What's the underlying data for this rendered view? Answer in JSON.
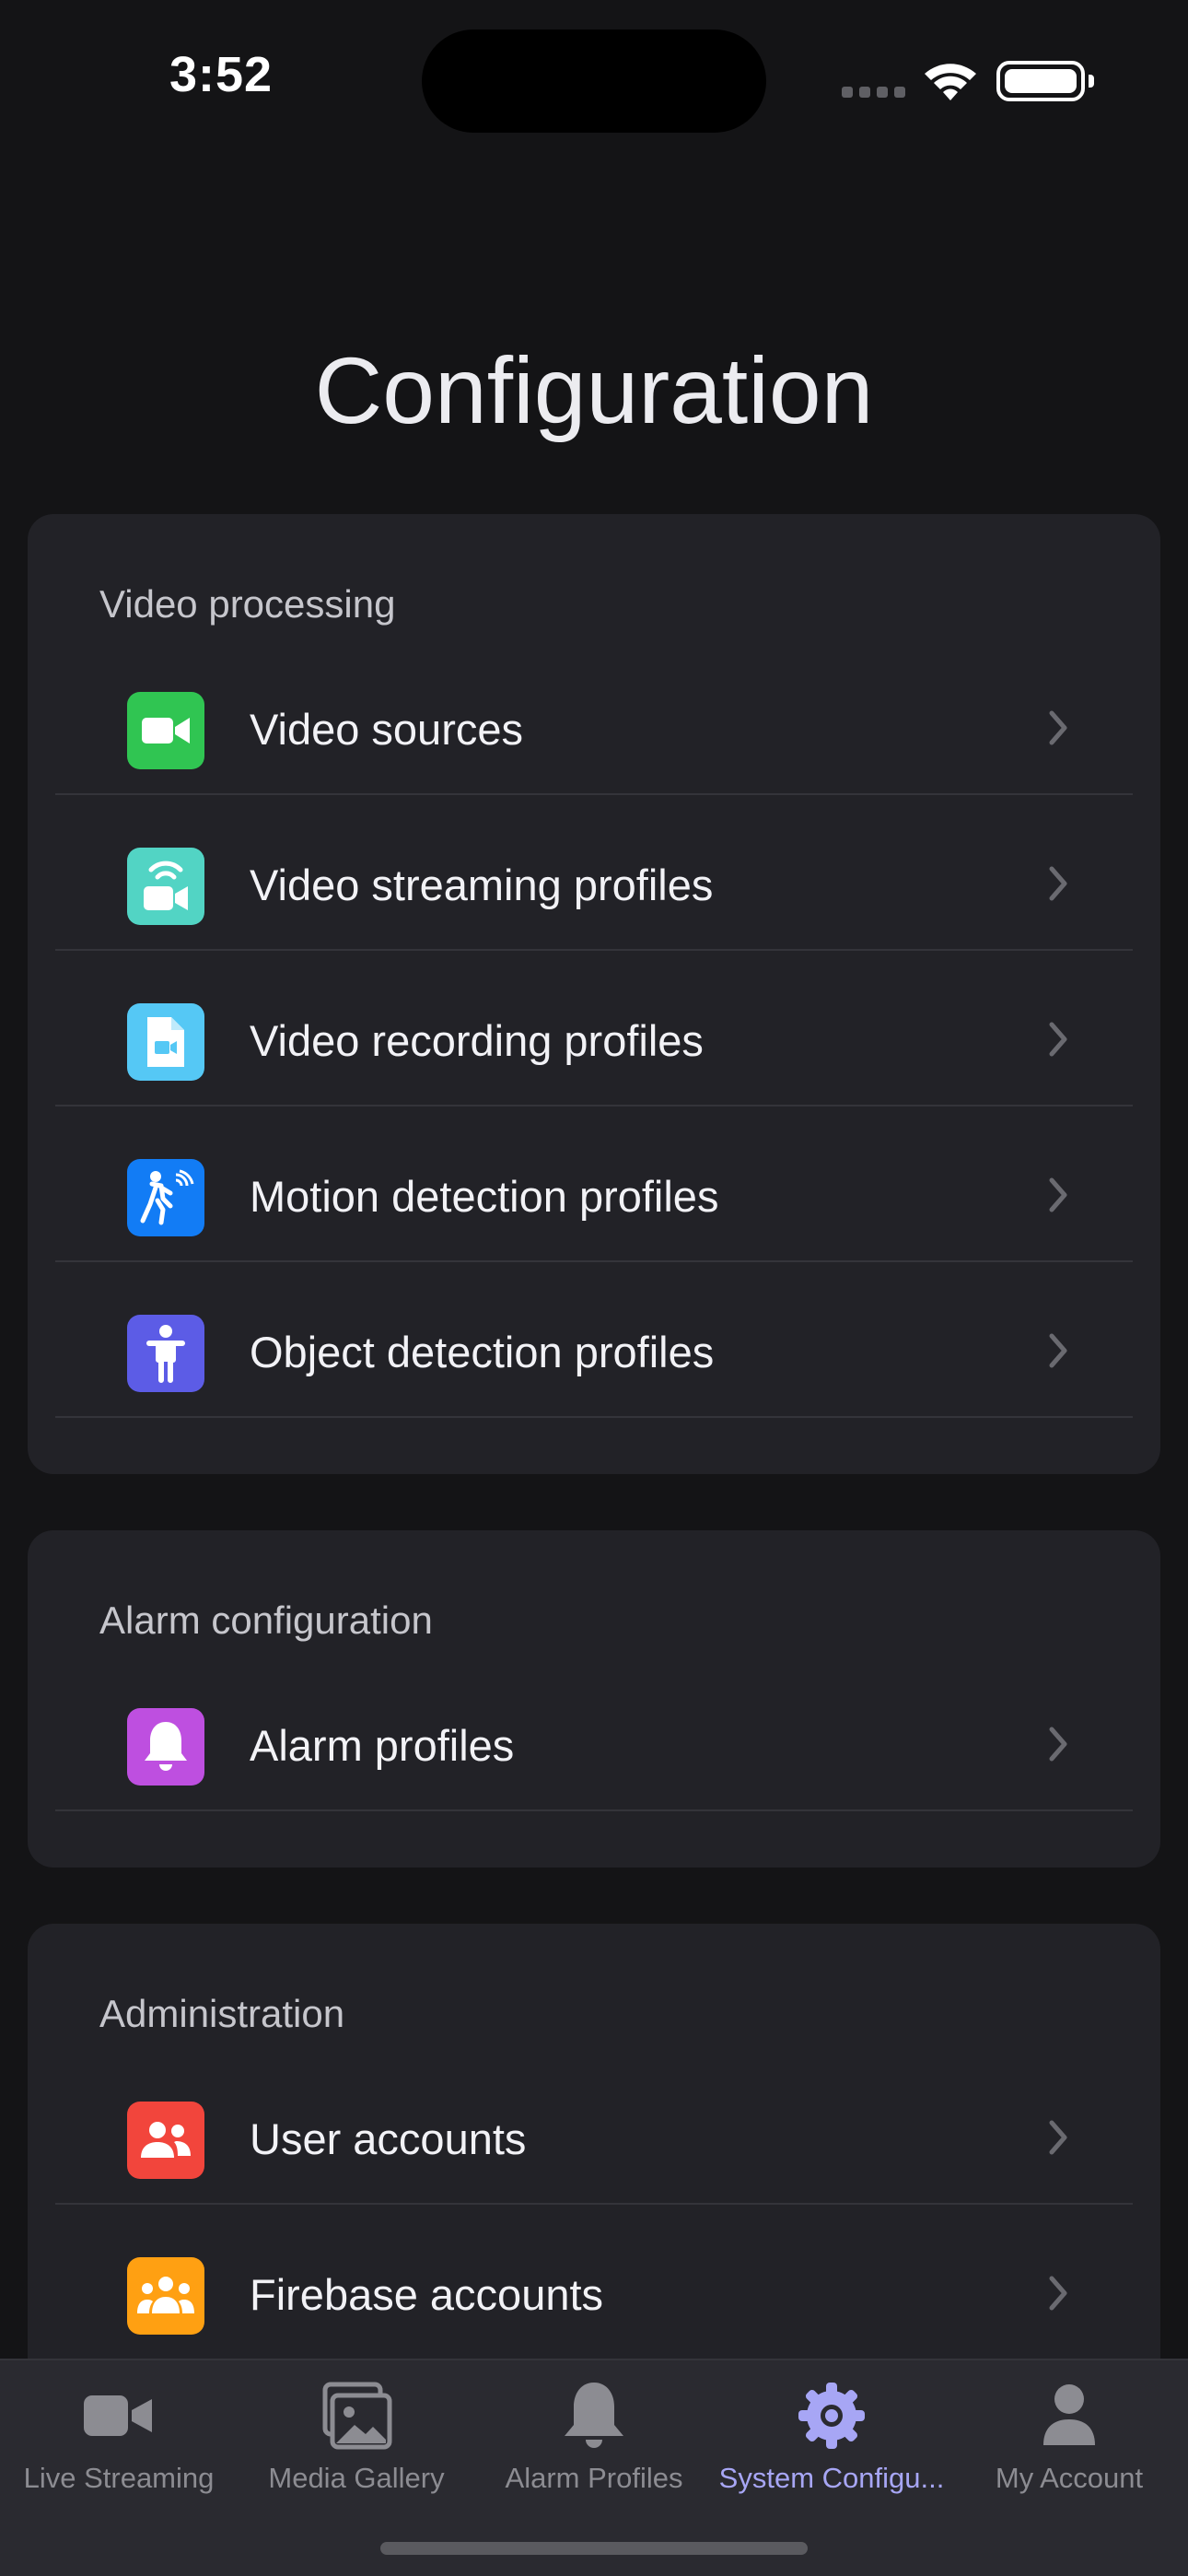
{
  "status_bar": {
    "time": "3:52"
  },
  "page": {
    "title": "Configuration"
  },
  "sections": [
    {
      "header": "Video processing",
      "items": [
        {
          "label": "Video sources",
          "icon": "video-camera-icon",
          "color": "#30C552"
        },
        {
          "label": "Video streaming profiles",
          "icon": "streaming-camera-icon",
          "color": "#52D4C4"
        },
        {
          "label": "Video recording profiles",
          "icon": "recording-file-icon",
          "color": "#55C8F5"
        },
        {
          "label": "Motion detection profiles",
          "icon": "motion-detection-icon",
          "color": "#127CF5"
        },
        {
          "label": "Object detection profiles",
          "icon": "person-icon",
          "color": "#5C5CE6"
        }
      ]
    },
    {
      "header": "Alarm configuration",
      "items": [
        {
          "label": "Alarm profiles",
          "icon": "bell-icon",
          "color": "#BE4FE0"
        }
      ]
    },
    {
      "header": "Administration",
      "items": [
        {
          "label": "User accounts",
          "icon": "users-icon",
          "color": "#F2453C"
        },
        {
          "label": "Firebase accounts",
          "icon": "group-icon",
          "color": "#FFA012"
        }
      ]
    }
  ],
  "tabbar": {
    "tabs": [
      {
        "label": "Live Streaming",
        "icon": "video-camera-icon",
        "active": false
      },
      {
        "label": "Media Gallery",
        "icon": "gallery-icon",
        "active": false
      },
      {
        "label": "Alarm Profiles",
        "icon": "bell-icon",
        "active": false
      },
      {
        "label": "System Configu...",
        "icon": "gear-icon",
        "active": true
      },
      {
        "label": "My Account",
        "icon": "person-icon",
        "active": false
      }
    ],
    "active_color": "#A7A6F5",
    "inactive_color": "#8C8C92"
  }
}
